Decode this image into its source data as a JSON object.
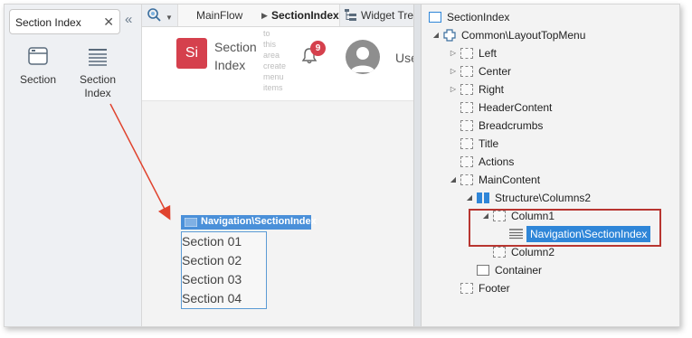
{
  "toolbox": {
    "search_value": "Section Index",
    "widgets": [
      {
        "label_line1": "Section",
        "label_line2": "",
        "icon": "section-icon"
      },
      {
        "label_line1": "Section",
        "label_line2": "Index",
        "icon": "section-index-icon"
      }
    ]
  },
  "tabs": {
    "flow": "MainFlow",
    "screen": "SectionIndex",
    "widget_tree": "Widget Tree"
  },
  "preview": {
    "logo_text": "Si",
    "app_name_line1": "Section",
    "app_name_line2": "Index",
    "menu_hint": [
      "to",
      "this",
      "area",
      "create",
      "menu",
      "items"
    ],
    "notification_count": "9",
    "user_name": "Use"
  },
  "placed_widget": {
    "chip_label": "Navigation\\SectionIndex",
    "items": [
      "Section 01",
      "Section 02",
      "Section 03",
      "Section 04"
    ]
  },
  "tree": {
    "root": "SectionIndex",
    "nodes": [
      {
        "label": "Common\\LayoutTopMenu"
      },
      {
        "label": "Left"
      },
      {
        "label": "Center"
      },
      {
        "label": "Right"
      },
      {
        "label": "HeaderContent"
      },
      {
        "label": "Breadcrumbs"
      },
      {
        "label": "Title"
      },
      {
        "label": "Actions"
      },
      {
        "label": "MainContent"
      },
      {
        "label": "Structure\\Columns2"
      },
      {
        "label": "Column1"
      },
      {
        "label": "Navigation\\SectionIndex"
      },
      {
        "label": "Column2"
      },
      {
        "label": "Container"
      },
      {
        "label": "Footer"
      }
    ]
  },
  "colors": {
    "accent": "#2f86d8",
    "brand_red": "#d5404d",
    "highlight_border": "#b83530",
    "arrow": "#e0432e"
  }
}
